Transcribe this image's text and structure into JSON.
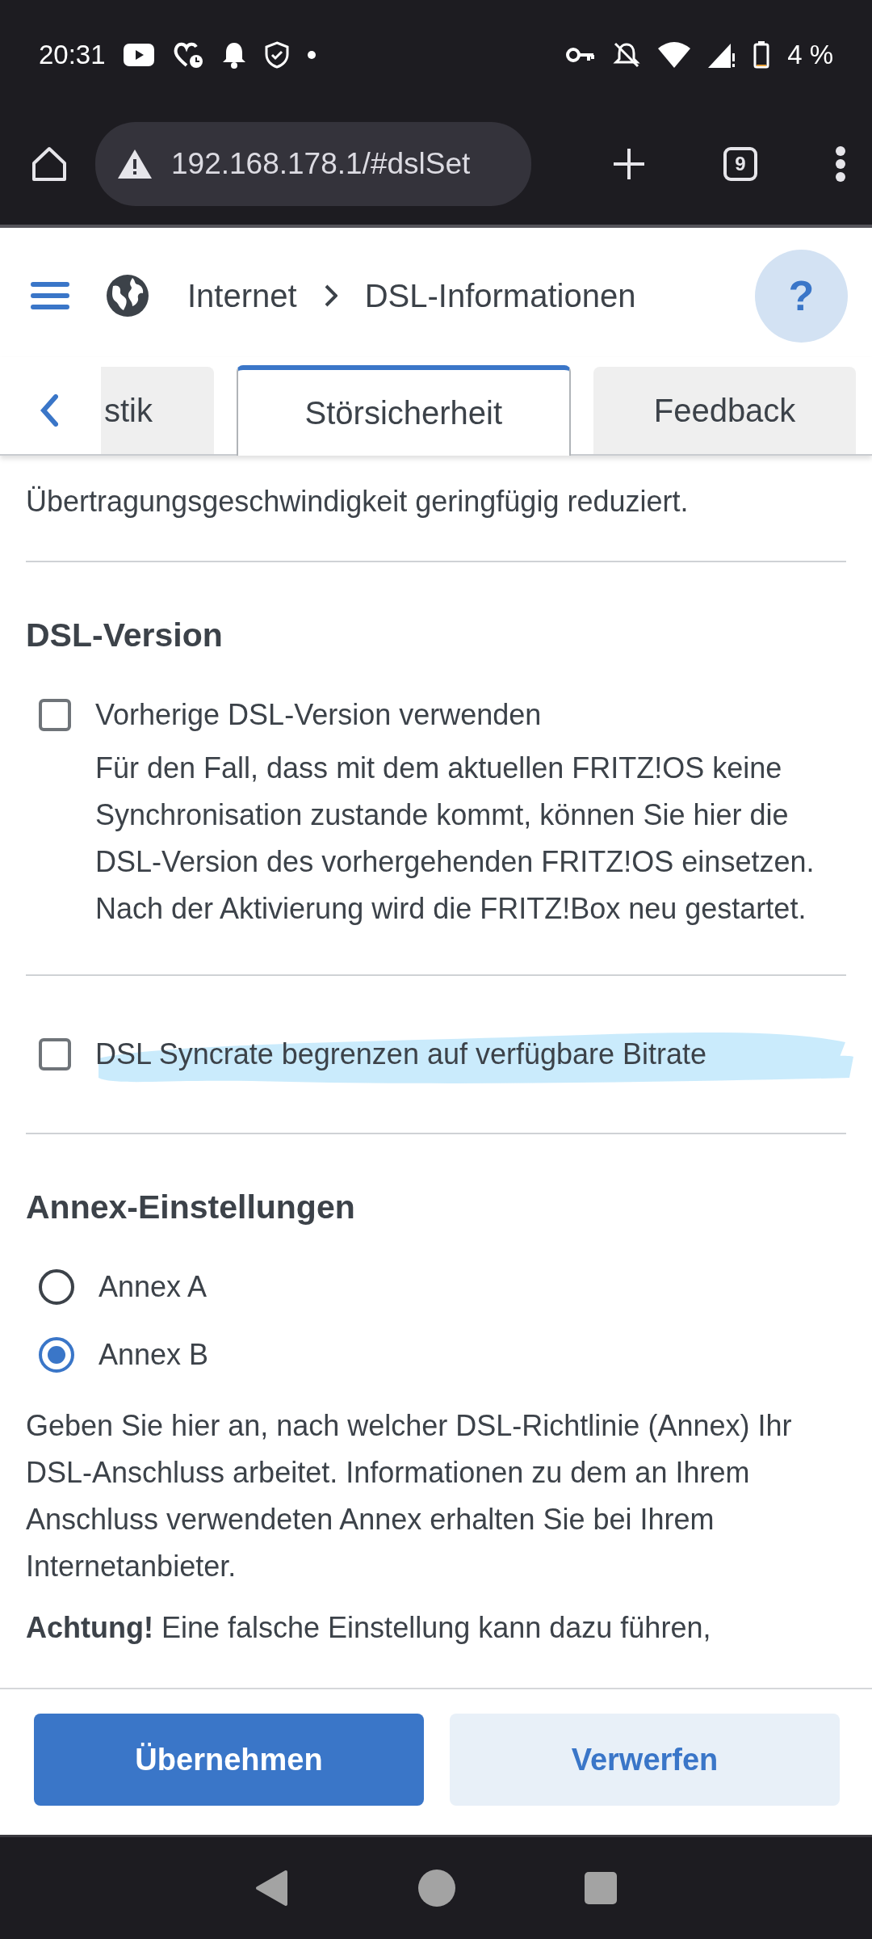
{
  "status_bar": {
    "time": "20:31",
    "battery": "4 %"
  },
  "browser": {
    "url": "192.168.178.1/#dslSet",
    "tab_count": "9"
  },
  "breadcrumb": [
    "Internet",
    "DSL-Informationen"
  ],
  "help_button": "?",
  "tabs": [
    {
      "label": "stik",
      "selected": false
    },
    {
      "label": "Störsicherheit",
      "selected": true
    },
    {
      "label": "Feedback",
      "selected": false
    }
  ],
  "intro_text": "Übertragungsgeschwindigkeit geringfügig reduziert.",
  "sections": [
    {
      "kind": "checkbox-group",
      "title": "DSL-Version",
      "options": [
        {
          "label": "Vorherige DSL-Version verwenden",
          "checked": false,
          "description": "Für den Fall, dass mit dem aktuellen FRITZ!OS keine Synchronisation zustande kommt, können Sie hier die DSL-Version des vorhergehenden FRITZ!OS einsetzen. Nach der Aktivierung wird die FRITZ!Box neu gestartet."
        }
      ]
    },
    {
      "kind": "checkbox-group",
      "options": [
        {
          "label": "DSL Syncrate begrenzen auf verfügbare Bitrate",
          "checked": false,
          "highlighted": true
        }
      ]
    },
    {
      "kind": "radio-group",
      "title": "Annex-Einstellungen",
      "options": [
        {
          "label": "Annex A",
          "selected": false
        },
        {
          "label": "Annex B",
          "selected": true
        }
      ],
      "description": "Geben Sie hier an, nach welcher DSL-Richtlinie (Annex) Ihr DSL-Anschluss arbeitet. Informationen zu dem an Ihrem Anschluss verwendeten Annex erhalten Sie bei Ihrem Internetanbieter.",
      "warning": "**Achtung!** Eine falsche Einstellung kann dazu führen,"
    }
  ],
  "buttons": [
    {
      "label": "Übernehmen",
      "kind": "primary"
    },
    {
      "label": "Verwerfen",
      "kind": "secondary"
    }
  ]
}
